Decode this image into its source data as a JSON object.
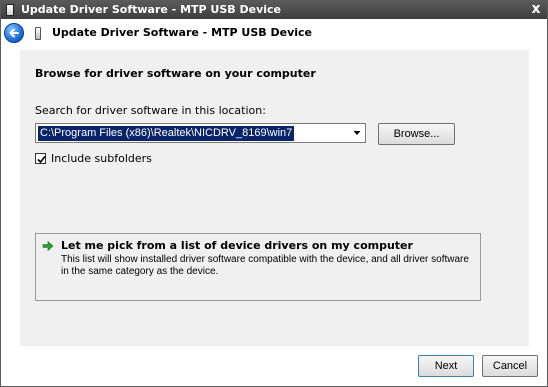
{
  "window": {
    "title": "Update Driver Software - MTP USB Device",
    "close_glyph": "x"
  },
  "header": {
    "title": "Update Driver Software - MTP USB Device"
  },
  "content": {
    "heading": "Browse for driver software on your computer",
    "search_label": "Search for driver software in this location:",
    "path_value": "C:\\Program Files (x86)\\Realtek\\NICDRV_8169\\win7",
    "browse_label": "Browse...",
    "include_subfolders_label": "Include subfolders",
    "include_subfolders_checked": true
  },
  "command_link": {
    "title": "Let me pick from a list of device drivers on my computer",
    "description": "This list will show installed driver software compatible with the device, and all driver software in the same category as the device."
  },
  "footer": {
    "next_label": "Next",
    "cancel_label": "Cancel"
  },
  "icons": {
    "back": "back-arrow-icon",
    "device": "usb-device-icon",
    "dropdown": "chevron-down-icon",
    "check": "checkmark-icon",
    "command_arrow": "green-arrow-icon"
  },
  "colors": {
    "titlebar": "#4a4a4a",
    "selection": "#0a246a",
    "panel": "#f0f0f0",
    "back_button": "#1f6fd6",
    "command_arrow": "#2ca02c"
  }
}
